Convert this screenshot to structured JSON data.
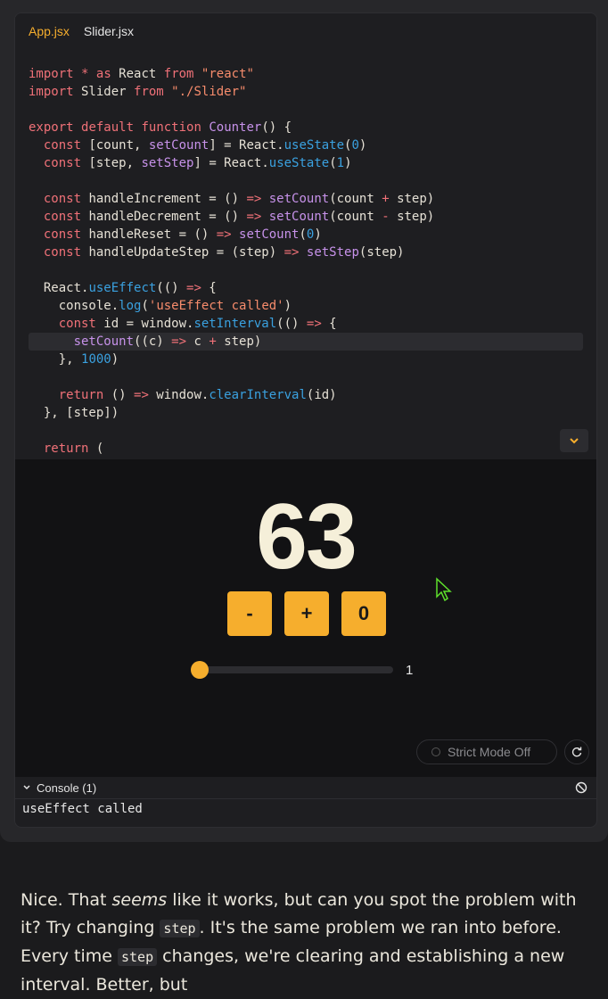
{
  "tabs": [
    {
      "label": "App.jsx",
      "active": true
    },
    {
      "label": "Slider.jsx",
      "active": false
    }
  ],
  "code_lines": [
    "import * as React from \"react\"",
    "import Slider from \"./Slider\"",
    "",
    "export default function Counter() {",
    "  const [count, setCount] = React.useState(0)",
    "  const [step, setStep] = React.useState(1)",
    "",
    "  const handleIncrement = () => setCount(count + step)",
    "  const handleDecrement = () => setCount(count - step)",
    "  const handleReset = () => setCount(0)",
    "  const handleUpdateStep = (step) => setStep(step)",
    "",
    "  React.useEffect(() => {",
    "    console.log('useEffect called')",
    "    const id = window.setInterval(() => {",
    "      setCount((c) => c + step)",
    "    }, 1000)",
    "",
    "    return () => window.clearInterval(id)",
    "  }, [step])",
    "",
    "  return ("
  ],
  "highlighted_line": 15,
  "preview": {
    "count": "63",
    "buttons": {
      "decrement": "-",
      "increment": "+",
      "reset": "0"
    },
    "slider": {
      "value": "1",
      "fraction": 0
    }
  },
  "strict_mode_label": "Strict Mode Off",
  "console": {
    "header": "Console (1)",
    "lines": [
      "useEffect called"
    ]
  },
  "prose": {
    "p1_a": "Nice. That ",
    "p1_em": "seems",
    "p1_b": " like it works, but can you spot the problem with it? Try changing ",
    "code1": "step",
    "p1_c": ". It's the same problem we ran into before. Every time ",
    "code2": "step",
    "p1_d": " changes, we're clearing and establishing a new interval. Better, but"
  },
  "colors": {
    "accent": "#f6ae2d",
    "background": "#1b1b1d",
    "preview_bg": "#121214"
  },
  "icons": [
    "chevron-down-icon",
    "cursor-icon",
    "refresh-icon",
    "clear-console-icon",
    "chevron-console-icon"
  ]
}
